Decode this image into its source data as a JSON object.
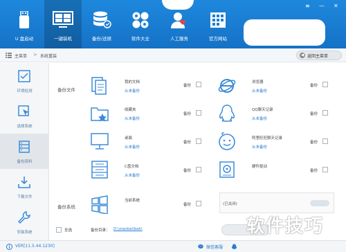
{
  "nav": {
    "items": [
      {
        "label": "U 盘启动",
        "icon": "usb-drive-icon"
      },
      {
        "label": "一键装机",
        "icon": "monitor-icon",
        "active": true
      },
      {
        "label": "备份/还原",
        "icon": "database-icon"
      },
      {
        "label": "软件大全",
        "icon": "apps-grid-icon"
      },
      {
        "label": "人工服务",
        "icon": "support-agent-icon"
      },
      {
        "label": "官方网站",
        "icon": "website-icon"
      }
    ],
    "window_controls": {
      "menu": "≡",
      "minimize": "—",
      "close": "✕"
    }
  },
  "breadcrumb": {
    "home": "主菜单",
    "separator": ">",
    "current": "系统重装",
    "back_button": "返回主菜单"
  },
  "sidebar": {
    "items": [
      {
        "label": "环境检测",
        "icon": "environment-check-icon"
      },
      {
        "label": "选择系统",
        "icon": "cursor-select-icon"
      },
      {
        "label": "备份资料",
        "icon": "backup-data-icon",
        "active": true
      },
      {
        "label": "下载文件",
        "icon": "download-icon"
      },
      {
        "label": "安装系统",
        "icon": "wrench-icon"
      }
    ]
  },
  "main": {
    "backup_files_label": "备份文件",
    "backup_system_label": "备份系统",
    "items": [
      {
        "name": "我的文档",
        "sub": "从未备份",
        "icon": "documents-icon",
        "check_label": "备份"
      },
      {
        "name": "收藏夹",
        "sub": "从未备份",
        "icon": "favorites-folder-icon",
        "check_label": "备份"
      },
      {
        "name": "桌面",
        "sub": "从未备份",
        "icon": "desktop-monitor-icon",
        "check_label": "备份"
      },
      {
        "name": "C盘文档",
        "sub": "从未备份",
        "icon": "drive-documents-icon",
        "check_label": "备份"
      },
      {
        "name": "浏览器",
        "sub": "从未备份",
        "icon": "browser-icon",
        "check_label": "备份"
      },
      {
        "name": "QQ聊天记录",
        "sub": "从未备份",
        "icon": "qq-penguin-icon",
        "check_label": "备份"
      },
      {
        "name": "阿里旺旺聊天记录",
        "sub": "从未备份",
        "icon": "aliwangwang-icon",
        "check_label": "备份"
      },
      {
        "name": "硬件驱动",
        "sub": "",
        "icon": "hardware-driver-icon",
        "check_label": "备份"
      }
    ],
    "system_item": {
      "name": "当前系统",
      "icon": "windows-logo-icon",
      "check_label": "备份"
    },
    "status_text": "(已关闭)",
    "select_all_label": "全选",
    "backup_dir_label": "备份目录：",
    "backup_dir_value": "D:\\xiaobai\\bak\\"
  },
  "watermark": "软件技巧",
  "statusbar": {
    "version": "VER[11.5.44.1230]",
    "wechat": "微信客服"
  },
  "colors": {
    "accent": "#1a7fd6",
    "link": "#2b7bd0",
    "icon": "#3b8bd8"
  }
}
